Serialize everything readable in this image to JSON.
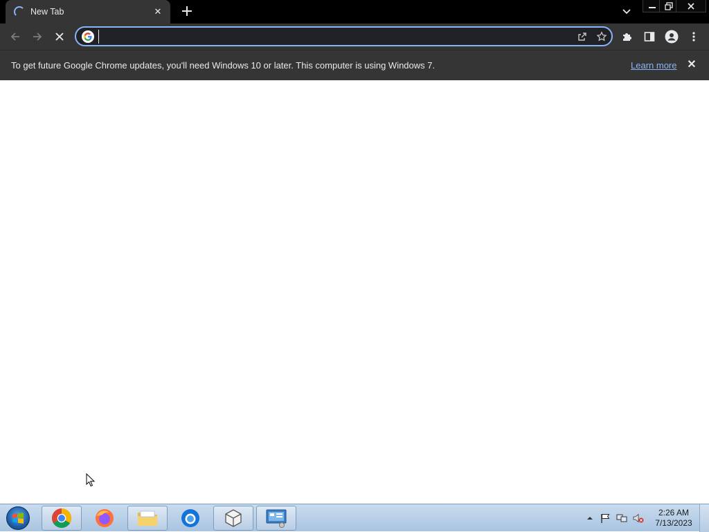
{
  "browser": {
    "tab": {
      "title": "New Tab",
      "close_icon": "close-icon",
      "loading": true
    },
    "new_tab_icon": "plus-icon",
    "tab_search_icon": "chevron-down-icon",
    "window_controls": [
      "minimize-icon",
      "restore-icon",
      "close-icon"
    ],
    "toolbar": {
      "back_icon": "arrow-left-icon",
      "forward_icon": "arrow-right-icon",
      "stop_icon": "close-icon",
      "omnibox": {
        "value": "",
        "placeholder": "",
        "focused": true
      },
      "share_icon": "share-icon",
      "bookmark_icon": "star-icon",
      "extensions_icon": "puzzle-icon",
      "side_panel_icon": "side-panel-icon",
      "profile_icon": "person-icon",
      "menu_icon": "kebab-menu-icon"
    },
    "infobar": {
      "message": "To get future Google Chrome updates, you'll need Windows 10 or later. This computer is using Windows 7.",
      "link": "Learn more"
    }
  },
  "taskbar": {
    "start_icon": "windows-logo-icon",
    "apps": [
      {
        "name": "Google Chrome",
        "icon": "chrome-icon",
        "active": true
      },
      {
        "name": "Firefox",
        "icon": "firefox-icon",
        "active": false
      },
      {
        "name": "Windows Explorer",
        "icon": "folder-icon",
        "active": true
      },
      {
        "name": "Thunderbird",
        "icon": "thunderbird-icon",
        "active": false
      },
      {
        "name": "VirtualBox",
        "icon": "box-icon",
        "active": true
      },
      {
        "name": "Control Panel",
        "icon": "control-panel-icon",
        "active": true
      }
    ],
    "tray": [
      "show-hidden-icons-icon",
      "action-center-flag-icon",
      "network-icon",
      "volume-muted-icon"
    ],
    "clock": {
      "time": "2:26 AM",
      "date": "7/13/2023"
    }
  },
  "colors": {
    "chrome_dark": "#353535",
    "titlebar": "#000000",
    "accent": "#8ab4f8",
    "text": "#e8eaed",
    "taskbar": "#b8cde4"
  }
}
